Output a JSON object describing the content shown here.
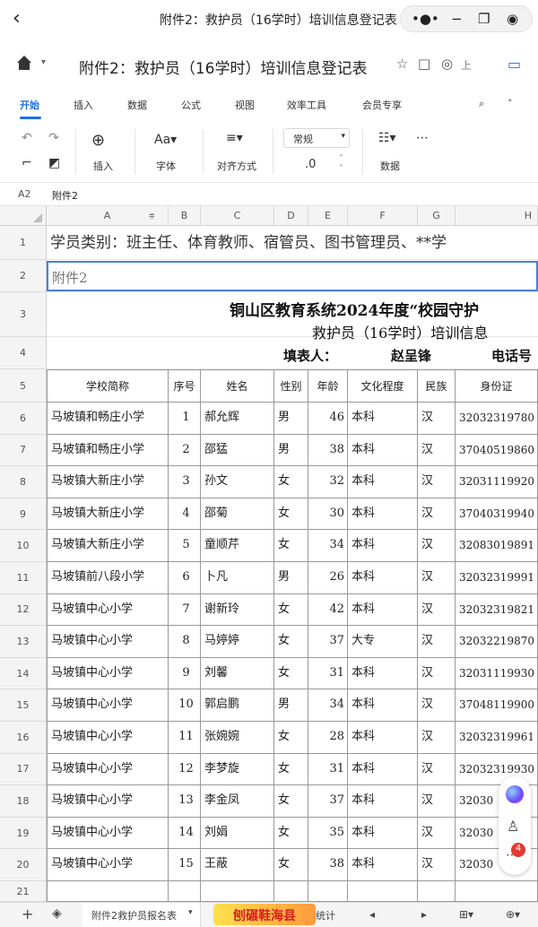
{
  "window": {
    "title": "附件2：救护员（16学时）培训信息登记表"
  },
  "doc_header": {
    "title": "附件2：救护员（16学时）培训信息登记表",
    "upload_label": "上"
  },
  "ribbon_tabs": [
    "开始",
    "插入",
    "数据",
    "公式",
    "视图",
    "效率工具",
    "会员专享"
  ],
  "toolbar": {
    "insert_label": "插入",
    "font_label": "字体",
    "align_label": "对齐方式",
    "number_format": "常规",
    "decimal_label": ".0",
    "data_label": "数据"
  },
  "formula_bar": {
    "cell_ref": "A2",
    "content": "附件2"
  },
  "columns": [
    "A",
    "B",
    "C",
    "D",
    "E",
    "F",
    "G",
    "H"
  ],
  "rows_numbers": [
    "1",
    "2",
    "3",
    "4",
    "5",
    "6",
    "7",
    "8",
    "9",
    "10",
    "11",
    "12",
    "13",
    "14",
    "15",
    "16",
    "17",
    "18",
    "19",
    "20",
    "21"
  ],
  "sheet": {
    "row1_text": "学员类别：班主任、体育教师、宿管员、图书管理员、**学",
    "row2_text": "附件2",
    "title_line1": "铜山区教育系统2024年度“校园守护",
    "title_line2": "救护员（16学时）培训信息",
    "filler_label": "填表人：",
    "filler_name": "赵呈锋",
    "phone_label": "电话号",
    "headers": [
      "学校简称",
      "序号",
      "姓名",
      "性别",
      "年龄",
      "文化程度",
      "民族",
      "身份证"
    ],
    "records": [
      [
        "马坡镇和畅庄小学",
        "1",
        "郝允辉",
        "男",
        "46",
        "本科",
        "汉",
        "32032319780"
      ],
      [
        "马坡镇和畅庄小学",
        "2",
        "邵猛",
        "男",
        "38",
        "本科",
        "汉",
        "37040519860"
      ],
      [
        "马坡镇大新庄小学",
        "3",
        "孙文",
        "女",
        "32",
        "本科",
        "汉",
        "32031119920"
      ],
      [
        "马坡镇大新庄小学",
        "4",
        "邵菊",
        "女",
        "30",
        "本科",
        "汉",
        "37040319940"
      ],
      [
        "马坡镇大新庄小学",
        "5",
        "童顺芹",
        "女",
        "34",
        "本科",
        "汉",
        "32083019891"
      ],
      [
        "马坡镇前八段小学",
        "6",
        "卜凡",
        "男",
        "26",
        "本科",
        "汉",
        "32032319991"
      ],
      [
        "马坡镇中心小学",
        "7",
        "谢新玲",
        "女",
        "42",
        "本科",
        "汉",
        "32032319821"
      ],
      [
        "马坡镇中心小学",
        "8",
        "马婷婷",
        "女",
        "37",
        "大专",
        "汉",
        "32032219870"
      ],
      [
        "马坡镇中心小学",
        "9",
        "刘馨",
        "女",
        "31",
        "本科",
        "汉",
        "32031119930"
      ],
      [
        "马坡镇中心小学",
        "10",
        "郭启鹏",
        "男",
        "34",
        "本科",
        "汉",
        "37048119900"
      ],
      [
        "马坡镇中心小学",
        "11",
        "张婉婉",
        "女",
        "28",
        "本科",
        "汉",
        "32032319961"
      ],
      [
        "马坡镇中心小学",
        "12",
        "李梦旋",
        "女",
        "31",
        "本科",
        "汉",
        "32032319930"
      ],
      [
        "马坡镇中心小学",
        "13",
        "李金凤",
        "女",
        "37",
        "本科",
        "汉",
        "32030"
      ],
      [
        "马坡镇中心小学",
        "14",
        "刘娟",
        "女",
        "35",
        "本科",
        "汉",
        "32030"
      ],
      [
        "马坡镇中心小学",
        "15",
        "王蔽",
        "女",
        "38",
        "本科",
        "汉",
        "32030"
      ]
    ]
  },
  "float": {
    "badge_count": "4"
  },
  "sheet_tabs": {
    "active": "附件2救护员报名表",
    "other": "统计",
    "watermark": "刨碾鞋海县"
  },
  "colors": {
    "accent": "#1e6fe8",
    "selection": "#4a7fd6",
    "badge": "#e53935"
  }
}
